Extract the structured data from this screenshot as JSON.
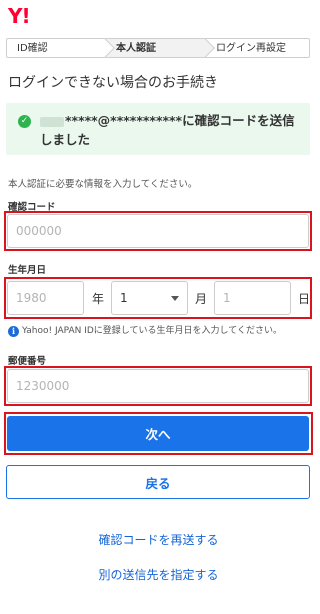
{
  "brand": {
    "logo": "Y!"
  },
  "steps": [
    {
      "label": "ID確認"
    },
    {
      "label": "本人認証"
    },
    {
      "label": "ログイン再設定"
    }
  ],
  "page": {
    "title": "ログインできない場合のお手続き"
  },
  "notice": {
    "message": "*****@***********に確認コードを送信しました"
  },
  "form": {
    "description": "本人認証に必要な情報を入力してください。",
    "code": {
      "label": "確認コード",
      "placeholder": "000000"
    },
    "birth": {
      "label": "生年月日",
      "year_placeholder": "1980",
      "year_unit": "年",
      "month_selected": "1",
      "month_unit": "月",
      "day_placeholder": "1",
      "day_unit": "日",
      "hint": "Yahoo! JAPAN IDに登録している生年月日を入力してください。"
    },
    "postal": {
      "label": "郵便番号",
      "placeholder": "1230000"
    }
  },
  "actions": {
    "next": "次へ",
    "back": "戻る"
  },
  "links": {
    "resend": "確認コードを再送する",
    "other_destination": "別の送信先を指定する"
  },
  "colors": {
    "primary": "#1a73e8",
    "highlight": "#d9141e",
    "success_bg": "#ebf8ee",
    "logo": "#ff0033"
  }
}
